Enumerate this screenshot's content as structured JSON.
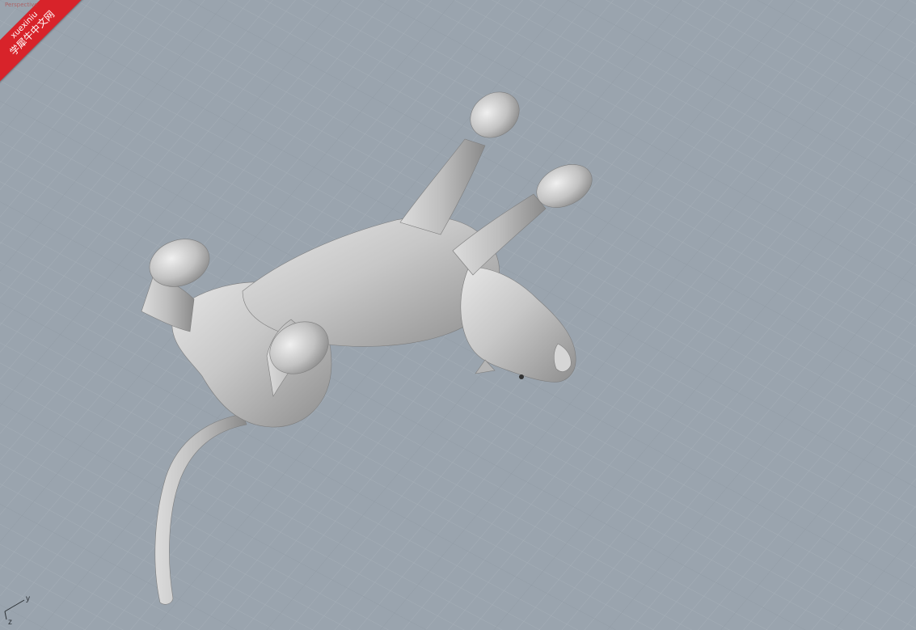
{
  "viewport": {
    "label": "Perspective",
    "axes": {
      "y_label": "y",
      "z_label": "z"
    },
    "colors": {
      "background": "#9aa4ae",
      "grid_minor": "#a7b0b8",
      "grid_major": "#8d97a1",
      "model": "#c4c4c4"
    }
  },
  "watermark": {
    "latin": "xuexiniu",
    "chinese": "学犀牛中文网",
    "color": "#d8232a"
  }
}
